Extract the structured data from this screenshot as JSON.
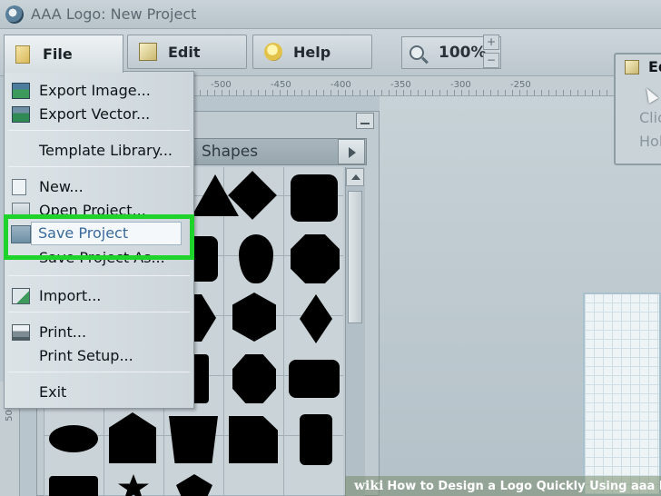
{
  "window": {
    "title": "AAA Logo: New Project"
  },
  "toolbar": {
    "file_label": "File",
    "edit_label": "Edit",
    "help_label": "Help",
    "zoom_value": "100%",
    "zoom_in": "+",
    "zoom_out": "−"
  },
  "ruler": {
    "marks": [
      "-500",
      "-450",
      "-400",
      "-350",
      "-300",
      "-250"
    ],
    "vertical_mark": "50"
  },
  "file_menu": {
    "items": [
      {
        "label": "Export Image...",
        "icon": "export-image-icon"
      },
      {
        "label": "Export Vector...",
        "icon": "export-vector-icon"
      },
      {
        "label": "Template Library...",
        "icon": ""
      },
      {
        "label": "New...",
        "icon": "new-file-icon"
      },
      {
        "label": "Open Project...",
        "icon": "open-project-icon"
      },
      {
        "label": "Save Project",
        "icon": "save-project-icon"
      },
      {
        "label": "Save Project As...",
        "icon": ""
      },
      {
        "label": "Import...",
        "icon": "import-icon"
      },
      {
        "label": "Print...",
        "icon": "printer-icon"
      },
      {
        "label": "Print Setup...",
        "icon": ""
      },
      {
        "label": "Exit",
        "icon": ""
      }
    ],
    "highlighted": "Save Project",
    "highlight_color": "#1ed42a"
  },
  "shapes_panel": {
    "title": "Shapes"
  },
  "edit_panel": {
    "title": "Ed",
    "line1": "Clic",
    "line2": "Hol"
  },
  "watermark": {
    "logo": "wiki",
    "text": "How to Design a Logo Quickly Using aaa logo"
  }
}
